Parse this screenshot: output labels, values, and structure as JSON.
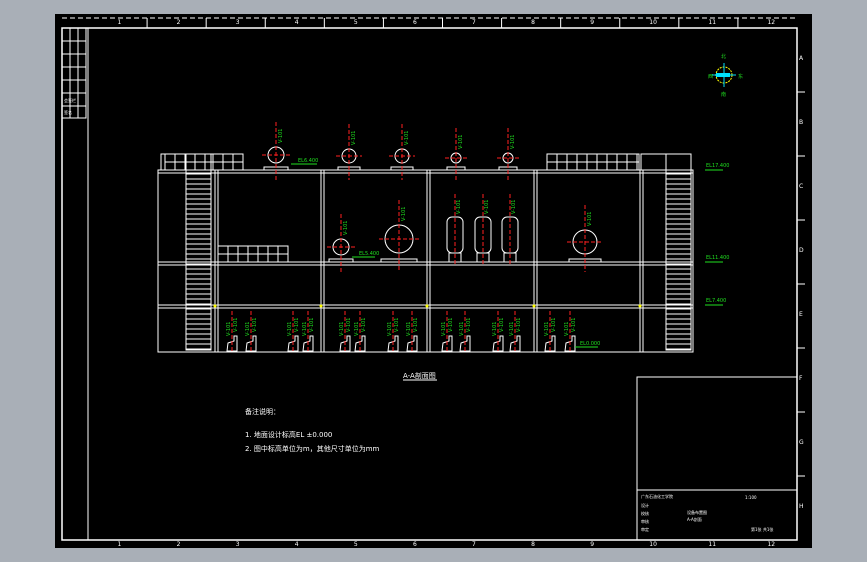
{
  "drawing": {
    "section_title": "A-A剖面图",
    "notes_title": "备注说明：",
    "notes": [
      "1. 地面设计标高EL ±0.000",
      "2. 图中标高单位为m，其他尺寸单位为mm"
    ],
    "compass": {
      "north": "北",
      "south": "南",
      "east": "东",
      "west": "西"
    },
    "side_table": [
      "会签栏",
      "签名"
    ],
    "column_labels": [
      "1",
      "2",
      "3",
      "4",
      "5",
      "6",
      "7",
      "8",
      "9",
      "10",
      "11",
      "12"
    ],
    "row_labels": [
      "A",
      "B",
      "C",
      "D",
      "E",
      "F",
      "G",
      "H"
    ],
    "elevations": [
      "EL17.400",
      "EL11.400",
      "EL7.400",
      "EL6.400",
      "EL5.400",
      "EL0.000"
    ],
    "equipment_tag": "V-101",
    "title_block": {
      "school": "广东石油化工学院",
      "drawing_name": "设备布置图",
      "sub_name": "A-A剖面",
      "scale": "1:100",
      "sheet": "第1张 共1张",
      "labels": [
        "设计",
        "校核",
        "审核",
        "审定"
      ]
    }
  },
  "colors": {
    "background": "#000000",
    "lines": "#ffffff",
    "centerlines": "#ff2020",
    "annotations": "#1fe01f",
    "compass": "#ffff00",
    "compass_cross": "#00e0ff"
  }
}
